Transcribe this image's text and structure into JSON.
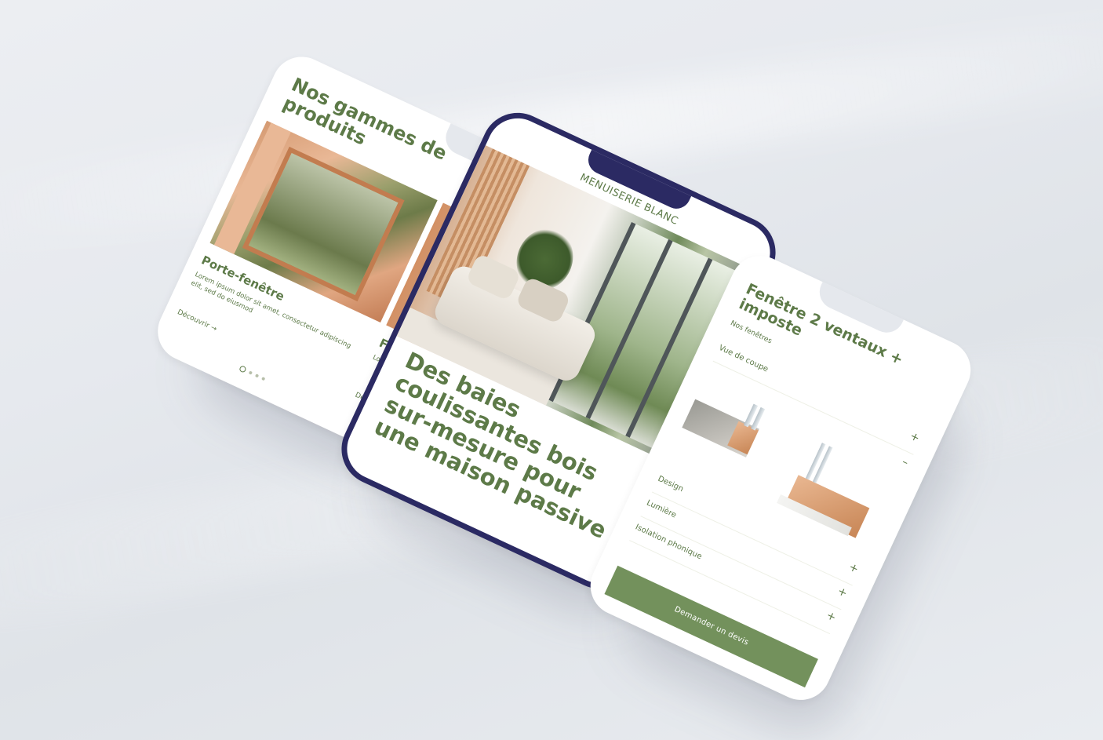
{
  "colors": {
    "brand_green": "#5d7a48",
    "button_green": "#73915c",
    "phone_frame": "#2b2a63",
    "background": "#e6e9ee"
  },
  "phone_left": {
    "title": "Nos gammes de produits",
    "cards": [
      {
        "name": "Porte-fenêtre",
        "description": "Lorem ipsum dolor sit amet, consectetur adipiscing elit, sed do eiusmod",
        "link": "Découvrir →"
      },
      {
        "name": "Fen",
        "description": "Lorem conse eiusm",
        "link": "Déco"
      }
    ],
    "carousel": {
      "count": 4,
      "active_index": 0
    }
  },
  "phone_center": {
    "brand": "MENUISERIE BLANC",
    "headline": "Des baies coulissantes bois sur-mesure pour une maison passive"
  },
  "phone_right": {
    "title": "Fenêtre 2 ventaux + imposte",
    "breadcrumb": "Nos fenêtres",
    "accordion": [
      {
        "label": "Vue de coupe",
        "sign": "+"
      },
      {
        "label": "",
        "sign": "–"
      },
      {
        "label": "Design",
        "sign": "+"
      },
      {
        "label": "Lumière",
        "sign": "+"
      },
      {
        "label": "Isolation phonique",
        "sign": "+"
      }
    ],
    "cta_label": "Demander un devis"
  }
}
